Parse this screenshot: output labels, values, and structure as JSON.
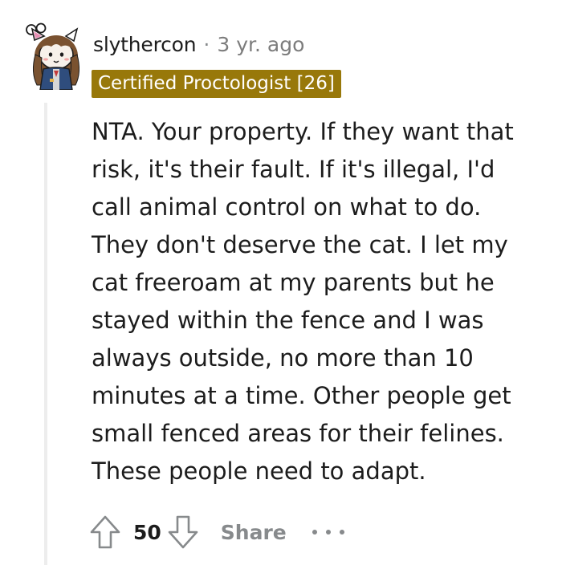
{
  "comment": {
    "author": "slythercon",
    "separator": "·",
    "timestamp": "3 yr. ago",
    "flair": "Certified Proctologist [26]",
    "body_lines": [
      "NTA. Your property. If they want that",
      "risk, it's their fault. If it's illegal, I'd",
      "call animal control on what to do.",
      "They don't deserve the cat. I let my",
      "cat freeroam at my parents but he",
      "stayed within the fence and I was",
      "always outside, no more than 10",
      "minutes at a time. Other people get",
      "small fenced areas for their felines.",
      "These people need to adapt."
    ]
  },
  "actions": {
    "upvote_icon": "arrow-up-icon",
    "score": "50",
    "downvote_icon": "arrow-down-icon",
    "share_label": "Share",
    "more_icon": "ellipsis-icon"
  },
  "colors": {
    "flair_background": "#98780a",
    "flair_text": "#ffffff",
    "muted": "#878a8c",
    "thread_line": "#ededed"
  }
}
